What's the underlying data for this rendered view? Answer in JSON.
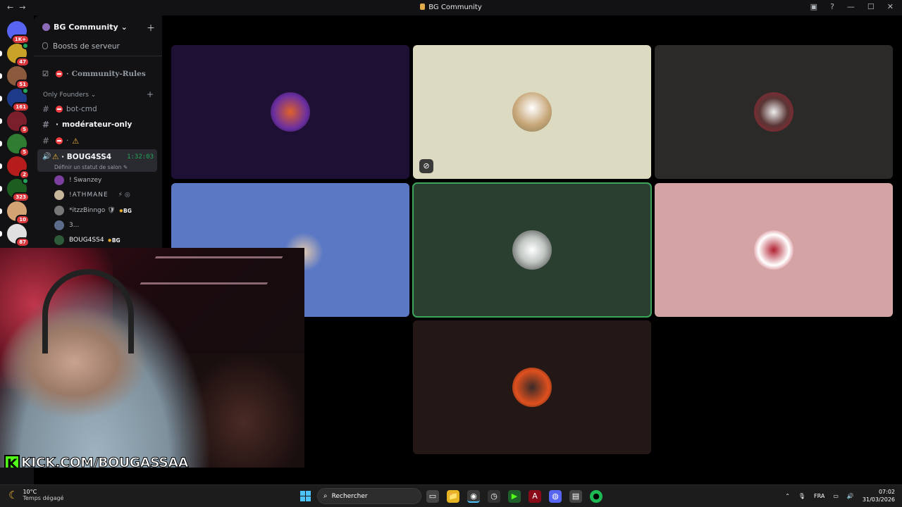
{
  "window": {
    "title": "BG Community",
    "nav_back": "←",
    "nav_forward": "→",
    "controls": [
      "▣",
      "?",
      "—",
      "☐",
      "✕"
    ]
  },
  "servers": [
    {
      "badge": "1K+",
      "color": "#5865f2",
      "active": true
    },
    {
      "badge": "47",
      "color": "#c9a227"
    },
    {
      "badge": "51",
      "color": "#8b5a3c"
    },
    {
      "badge": "161",
      "color": "#1e3a8a"
    },
    {
      "badge": "5",
      "color": "#7a1f2b"
    },
    {
      "badge": "5",
      "color": "#2e7d32"
    },
    {
      "badge": "2",
      "color": "#b71c1c"
    },
    {
      "badge": "323",
      "color": "#1b5e20"
    },
    {
      "badge": "10",
      "color": "#d4a373"
    },
    {
      "badge": "87",
      "color": "#e0e0e0"
    }
  ],
  "guild": {
    "name": "BG Community",
    "chevron": "⌄",
    "invite_icon": "＋",
    "boost_label": "Boosts de serveur"
  },
  "channels": {
    "rules": "Community-Rules",
    "category": "Only Founders",
    "category_chevron": "⌄",
    "category_add": "+",
    "bot": "bot-cmd",
    "mod": "modérateur-only",
    "warn_channel": "⚠"
  },
  "voice": {
    "icon": "🔊",
    "name": "BOUG4SS4",
    "prefix_icon": "⚠",
    "timer": "1:32:03",
    "status": "Définir un statut de salon ✎"
  },
  "members": [
    {
      "name": "! Swanzey",
      "color": "#7b3fa0"
    },
    {
      "name": "!ATHMANE",
      "color": "#c7b79a",
      "icons": "⚡ ◎"
    },
    {
      "name": "*itzzBinngo",
      "color": "#777777",
      "suffix": "🛡",
      "tag": "BG"
    },
    {
      "name": "3...",
      "color": "#5d6b8a"
    },
    {
      "name": "BOUG4SS4",
      "color": "#2e5a3a",
      "tag": "BG"
    }
  ],
  "tiles": [
    {
      "bg": "#1e0f35",
      "avatar_color": "#6a2fa0",
      "speaking": false
    },
    {
      "bg": "#dcdac0",
      "avatar_color": "#c8a87a",
      "speaking": false,
      "muted_icon": "⊘"
    },
    {
      "bg": "#2c2a28",
      "avatar_color": "#5a3535",
      "speaking": false
    },
    {
      "bg": "#5a78c4",
      "avatar_color": "#e0c8b0",
      "speaking": false
    },
    {
      "bg": "#2a3f30",
      "avatar_color": "#bfc6c2",
      "speaking": true
    },
    {
      "bg": "#d4a3a4",
      "avatar_color": "#b02030",
      "speaking": false
    },
    {
      "bg": "#231816",
      "avatar_color": "#e0501e",
      "speaking": false
    }
  ],
  "stream": {
    "k_letter": "K",
    "overlay_text": "KICK.COM/BOUGASSAA"
  },
  "taskbar": {
    "temp": "10°C",
    "weather": "Temps dégagé",
    "search_placeholder": "Rechercher",
    "lang": "FRA",
    "time": "07:02",
    "date": "31/03/2026",
    "apps": [
      "▭",
      "📁",
      "◉",
      "◷",
      "▶",
      "A",
      "◍",
      "▤",
      "●"
    ]
  }
}
